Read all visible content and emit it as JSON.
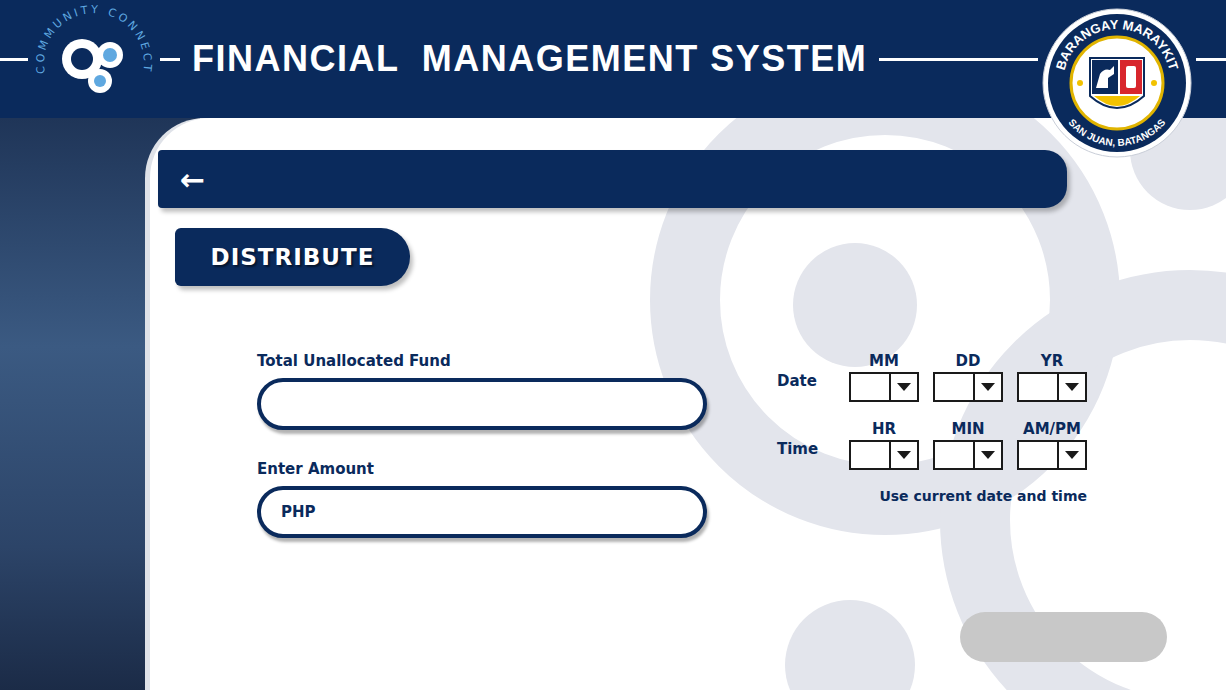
{
  "header": {
    "title": "FINANCIAL  MANAGEMENT SYSTEM",
    "logo_text": "COMMUNITY CONNECT",
    "seal_top": "BARANGAY MARAYKIT",
    "seal_bottom": "SAN JUAN, BATANGAS"
  },
  "nav": {
    "back": "←"
  },
  "section_tab": "DISTRIBUTE",
  "fields": [
    {
      "label": "Total Unallocated Fund",
      "prefix": ""
    },
    {
      "label": "Enter Amount",
      "prefix": "PHP"
    }
  ],
  "datetime": {
    "rows": [
      {
        "label": "Date",
        "parts": [
          "MM",
          "DD",
          "YR"
        ]
      },
      {
        "label": "Time",
        "parts": [
          "HR",
          "MIN",
          "AM/PM"
        ]
      }
    ],
    "current_link": "Use current date and time"
  },
  "submit_button": {
    "disabled": true
  }
}
